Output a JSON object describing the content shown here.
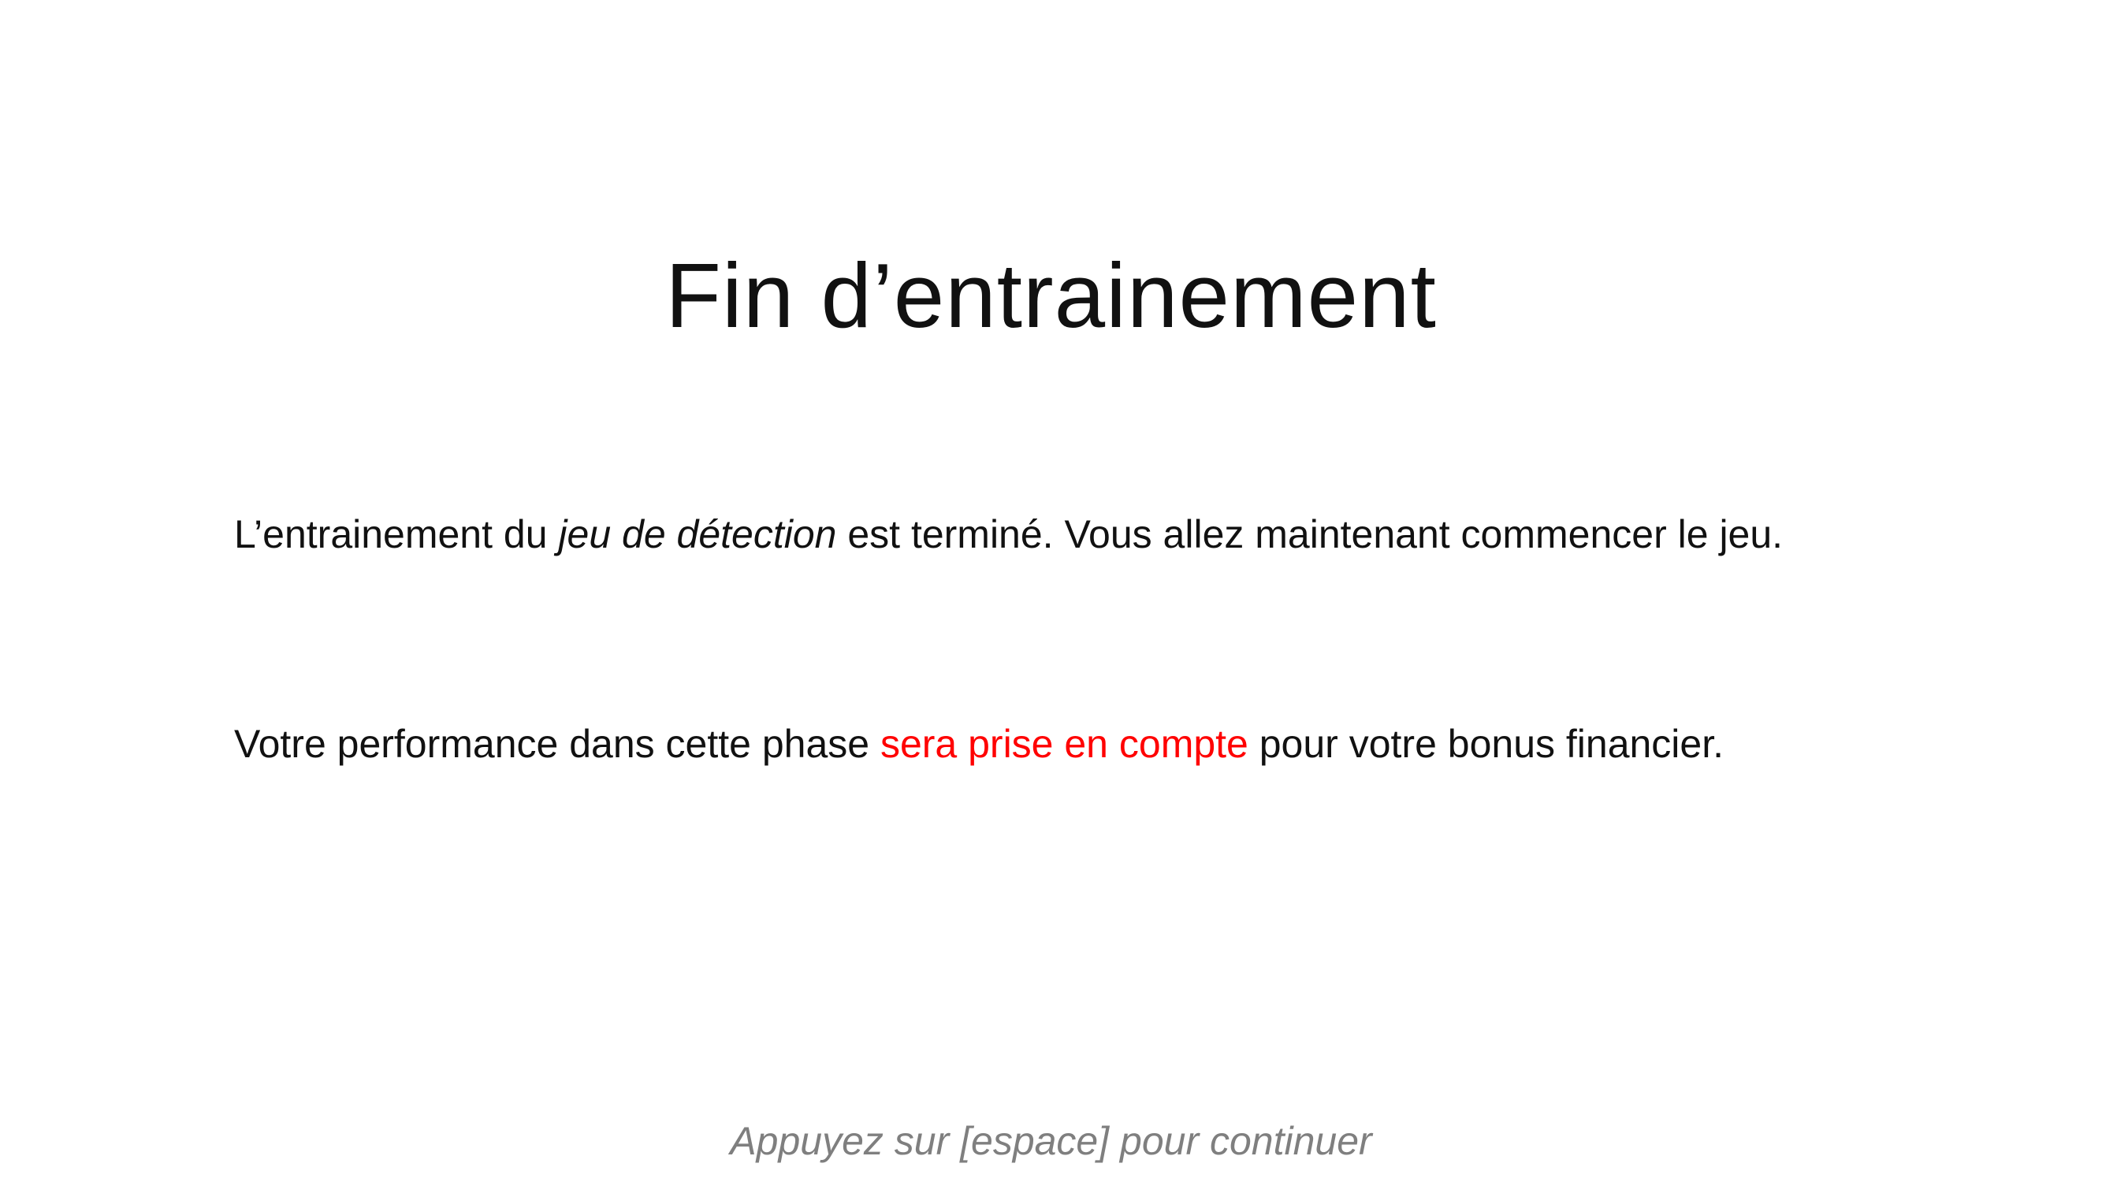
{
  "slide": {
    "title": "Fin d’entrainement",
    "paragraph1": {
      "before": "L’entrainement du ",
      "italic": "jeu de détection",
      "after": " est terminé.  Vous allez maintenant commencer le jeu."
    },
    "paragraph2": {
      "before": "Votre performance dans cette phase ",
      "highlight": "sera prise en compte",
      "after": " pour votre bonus financier."
    },
    "footer": "Appuyez sur [espace] pour continuer"
  },
  "colors": {
    "background": "#ffffff",
    "text": "#111111",
    "highlight": "#ff0000",
    "footer": "#7f7f7f"
  }
}
